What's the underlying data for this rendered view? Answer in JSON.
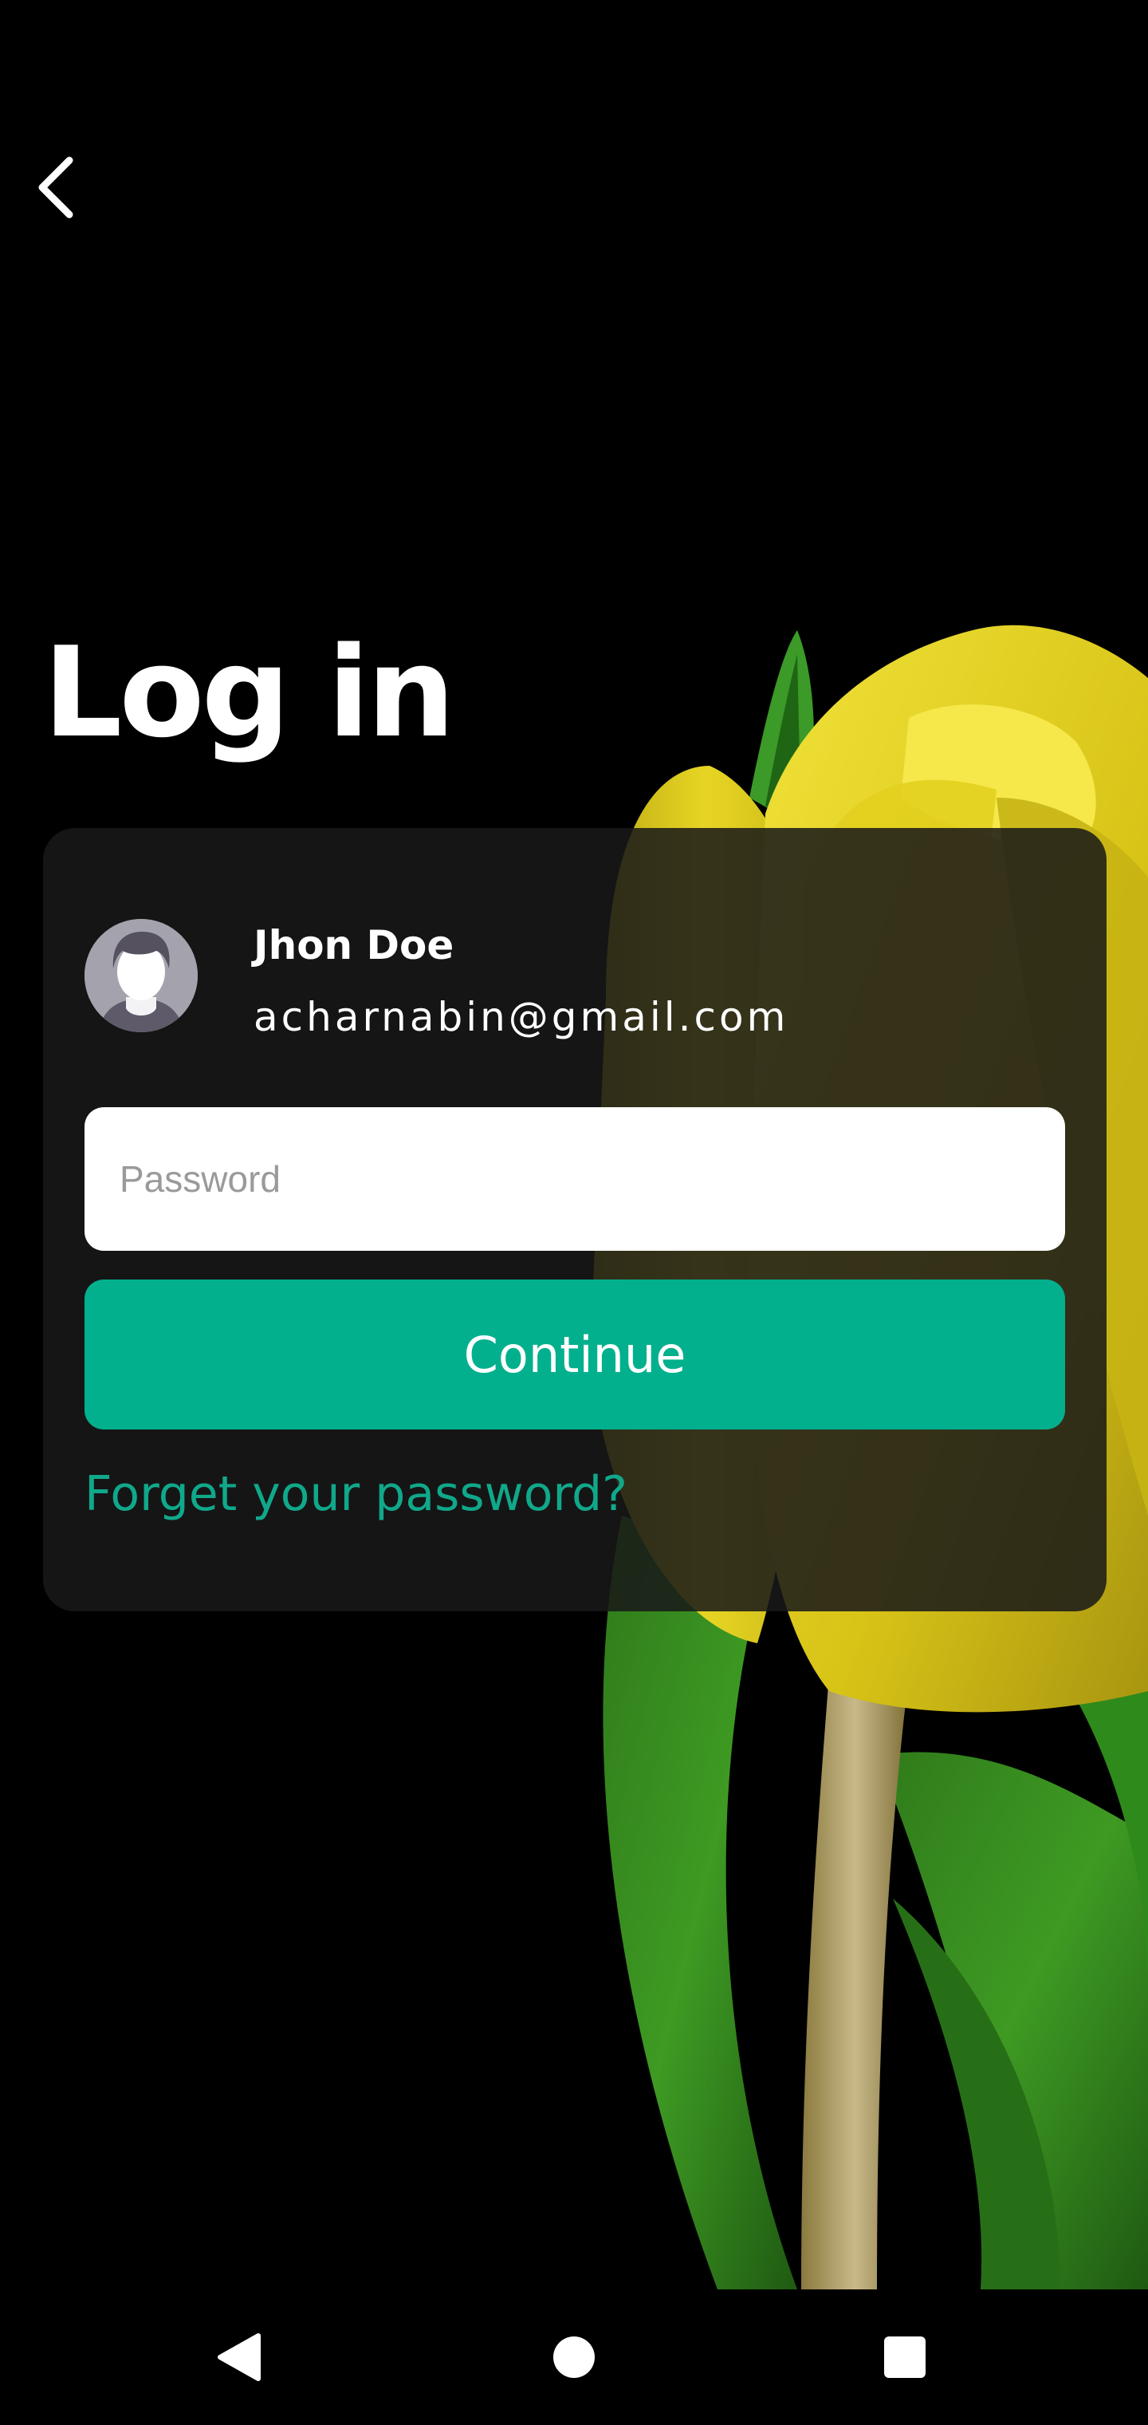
{
  "header": {
    "back_icon": "chevron-left-icon",
    "title": "Log in"
  },
  "account": {
    "avatar_icon": "user-avatar-icon",
    "name": "Jhon Doe",
    "email": "acharnabin@gmail.com"
  },
  "form": {
    "password_placeholder": "Password",
    "password_value": "",
    "continue_label": "Continue",
    "forgot_label": "Forget your password?"
  },
  "navigation_bar": {
    "back_icon": "triangle-back-icon",
    "home_icon": "circle-home-icon",
    "recents_icon": "square-recents-icon"
  },
  "colors": {
    "background": "#000000",
    "card": "#191919",
    "accent": "#03b08e",
    "link": "#10a88a",
    "text": "#ffffff",
    "tulip": "#e6d21d"
  }
}
